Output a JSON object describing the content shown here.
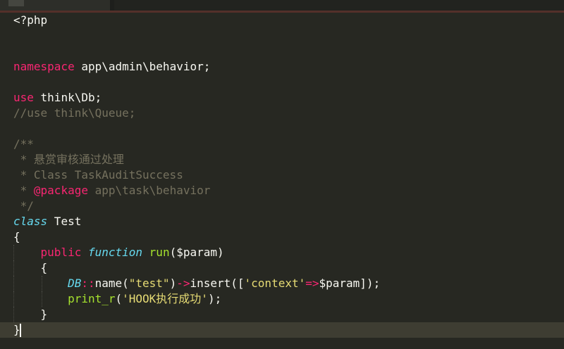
{
  "editor": {
    "tokens": {
      "php_open": "<?php",
      "namespace_kw": "namespace",
      "namespace_path": " app\\admin\\behavior;",
      "use_kw": "use",
      "use_path": " think\\Db;",
      "commented_use": "//use think\\Queue;",
      "doc_open": "/**",
      "doc_line1": " * 悬赏审核通过处理",
      "doc_line2": " * Class TaskAuditSuccess",
      "doc_star": " * ",
      "doc_tag": "@package",
      "doc_tag_value": " app\\task\\behavior",
      "doc_close": " */",
      "class_kw": "class",
      "class_name": " Test",
      "brace_open": "{",
      "brace_close": "}",
      "indent_1": "    ",
      "indent_2": "        ",
      "public_kw": "public",
      "function_kw": "function",
      "space": " ",
      "method_name": "run",
      "method_params": "($param)",
      "db_class": "DB",
      "scope_op": "::",
      "name_call": "name(",
      "test_string": "\"test\"",
      "close_paren": ")",
      "arrow_op": "->",
      "insert_call": "insert([",
      "context_key": "'context'",
      "double_arrow": "=>",
      "insert_tail": "$param]);",
      "print_fn": "print_r",
      "open_paren": "(",
      "hook_string": "'HOOK执行成功'",
      "print_tail": ");"
    }
  }
}
